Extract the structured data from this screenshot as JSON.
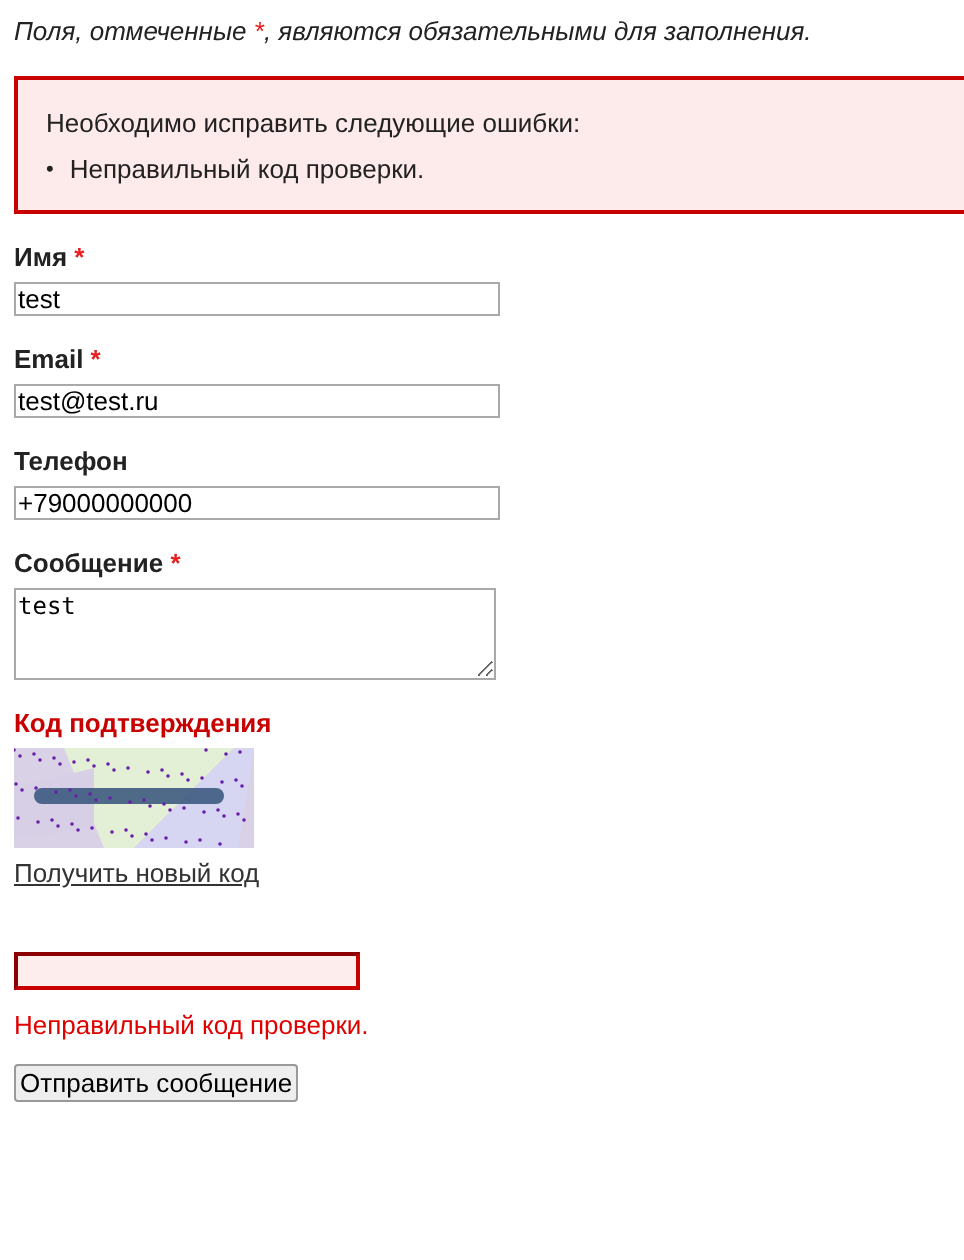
{
  "notice": {
    "before": "Поля, отмеченные ",
    "mark": "*",
    "after": ", являются обязательными для заполнения."
  },
  "error_box": {
    "title": "Необходимо исправить следующие ошибки:",
    "bullet": "•",
    "items": [
      "Неправильный код проверки."
    ]
  },
  "fields": [
    {
      "label": "Имя",
      "mark": "*",
      "kind": "input",
      "value": "test"
    },
    {
      "label": "Email",
      "mark": "*",
      "kind": "input",
      "value": "test@test.ru"
    },
    {
      "label": "Телефон",
      "kind": "input",
      "value": "+79000000000"
    },
    {
      "label": "Сообщение",
      "mark": "*",
      "kind": "textarea",
      "value": "test"
    }
  ],
  "captcha": {
    "label": "Код подтверждения",
    "invalid": true,
    "refresh_link": "Получить новый код",
    "error": "Неправильный код проверки."
  },
  "submit": "Отправить сообщение"
}
